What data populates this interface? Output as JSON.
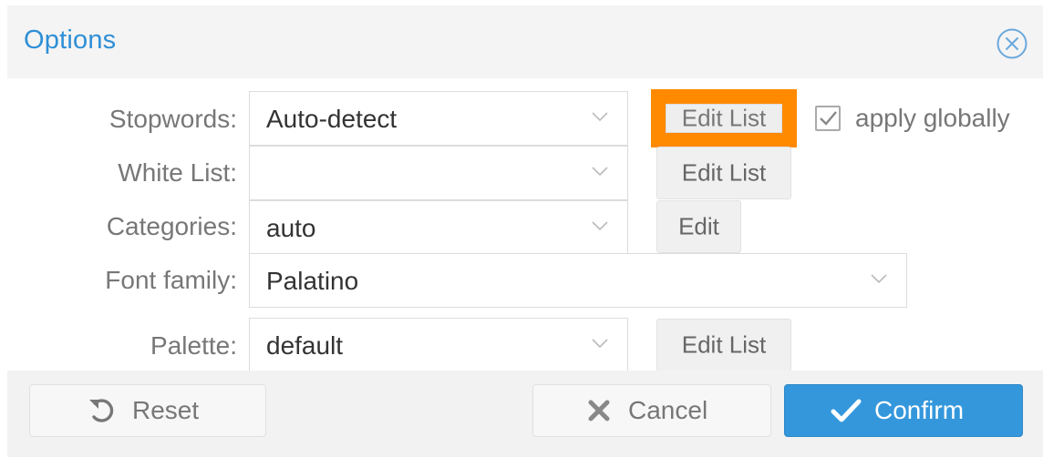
{
  "dialog": {
    "title": "Options",
    "close_icon": "close-circle-icon"
  },
  "form": {
    "stopwords": {
      "label": "Stopwords:",
      "value": "Auto-detect",
      "button": "Edit List"
    },
    "apply_globally": {
      "label": "apply globally",
      "checked": true
    },
    "white_list": {
      "label": "White List:",
      "value": "",
      "button": "Edit List"
    },
    "categories": {
      "label": "Categories:",
      "value": "auto",
      "button": "Edit"
    },
    "font_family": {
      "label": "Font family:",
      "value": "Palatino"
    },
    "palette": {
      "label": "Palette:",
      "value": "default",
      "button": "Edit List"
    }
  },
  "footer": {
    "reset": "Reset",
    "cancel": "Cancel",
    "confirm": "Confirm"
  },
  "colors": {
    "accent": "#2f8fd6",
    "confirm_bg": "#3497dc",
    "highlight": "#ff8a00"
  }
}
